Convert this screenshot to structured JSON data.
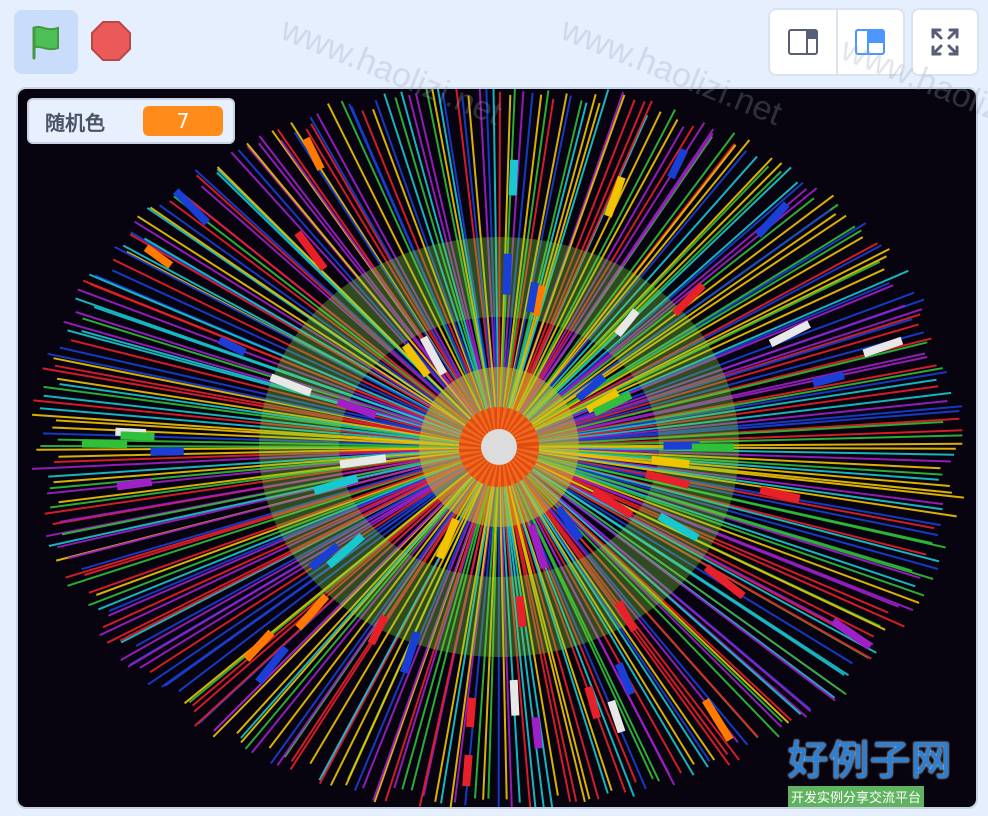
{
  "toolbar": {
    "green_flag": {
      "icon": "green-flag-icon",
      "color": "#4cbf56"
    },
    "stop": {
      "icon": "stop-sign-icon",
      "color": "#ec5959"
    },
    "small_stage": {
      "icon": "small-stage-icon"
    },
    "normal_stage": {
      "icon": "large-stage-icon",
      "accent": "#4c97ff"
    },
    "fullscreen": {
      "icon": "fullscreen-icon"
    }
  },
  "monitor": {
    "label": "随机色",
    "value": "7",
    "value_color": "#ff8c1a"
  },
  "stage": {
    "background": "#07040f",
    "palette": [
      "#e8202a",
      "#f0c400",
      "#2fbf3a",
      "#1a3fd6",
      "#a020c8",
      "#18c8d0",
      "#ff7a00",
      "#e8e8e8"
    ]
  },
  "watermark": {
    "url_text": "www.haolizi.net",
    "logo_text": "好例子网",
    "logo_sub": "开发实例分享交流平台"
  }
}
